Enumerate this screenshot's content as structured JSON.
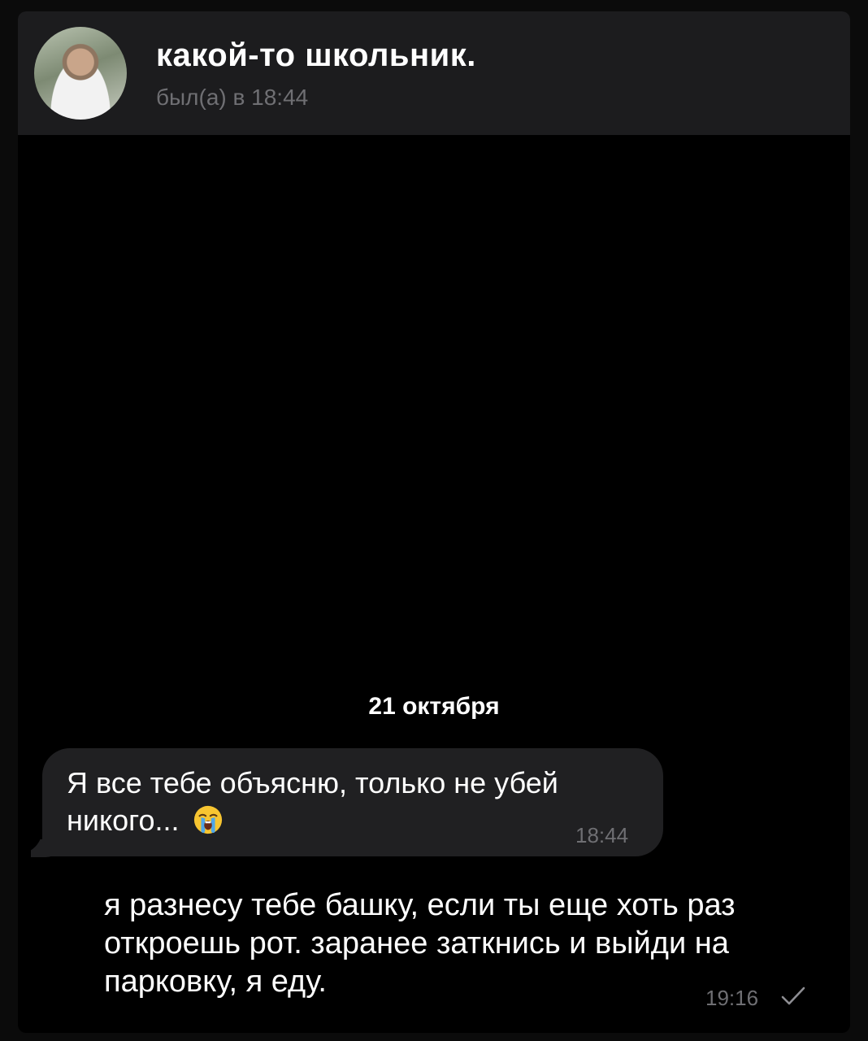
{
  "header": {
    "contact_name": "какой-то школьник.",
    "last_seen": "был(а) в 18:44",
    "avatar_icon": "avatar-photo"
  },
  "chat": {
    "date_separator": "21 октября",
    "messages": [
      {
        "direction": "incoming",
        "text": "Я все тебе объясню, только не убей никого...",
        "emoji": "loudly-crying-face",
        "time": "18:44"
      },
      {
        "direction": "outgoing",
        "text": "я разнесу тебе башку, если ты еще хоть раз откроешь рот. заранее заткнись и выйди на парковку, я еду.",
        "time": "19:16",
        "status_icon": "check-icon"
      }
    ]
  },
  "colors": {
    "background": "#000000",
    "header_bg": "#1c1c1e",
    "incoming_bubble": "#202022",
    "secondary_text": "#6f6f73",
    "primary_text": "#ffffff"
  }
}
